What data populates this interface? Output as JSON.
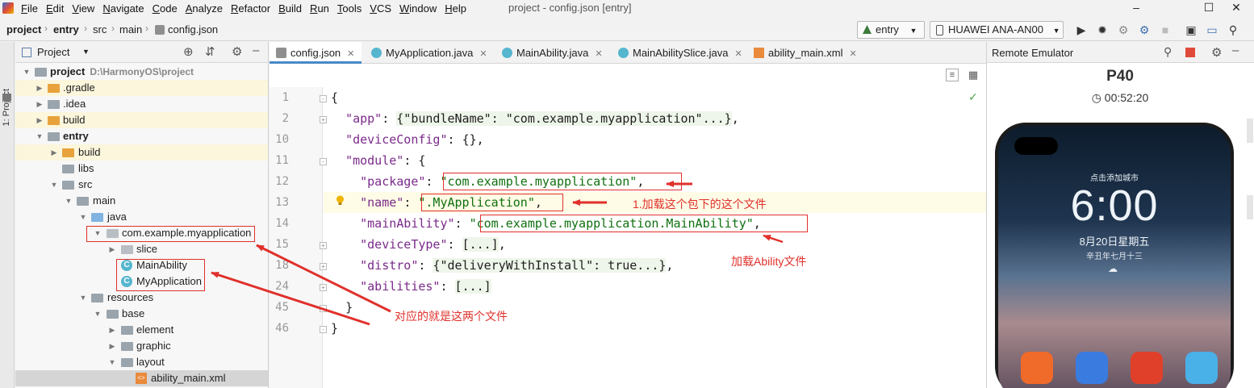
{
  "menubar": {
    "items": [
      "File",
      "Edit",
      "View",
      "Navigate",
      "Code",
      "Analyze",
      "Refactor",
      "Build",
      "Run",
      "Tools",
      "VCS",
      "Window",
      "Help"
    ],
    "window_title": "project - config.json [entry]"
  },
  "navbar": {
    "breadcrumb": [
      "project",
      "entry",
      "src",
      "main",
      "config.json"
    ],
    "run_config": "entry",
    "device": "HUAWEI ANA-AN00"
  },
  "stripe": {
    "label": "1: Project"
  },
  "project_panel": {
    "title": "Project",
    "tree": [
      {
        "label": "project",
        "path": "D:\\HarmonyOS\\project",
        "icon": "folder",
        "level": 0
      },
      {
        "label": ".gradle",
        "icon": "folder",
        "level": 1
      },
      {
        "label": ".idea",
        "icon": "folder",
        "level": 1
      },
      {
        "label": "build",
        "icon": "folder",
        "level": 1
      },
      {
        "label": "entry",
        "icon": "folder",
        "level": 1
      },
      {
        "label": "build",
        "icon": "folder",
        "level": 2
      },
      {
        "label": "libs",
        "icon": "folder",
        "level": 2
      },
      {
        "label": "src",
        "icon": "folder",
        "level": 2
      },
      {
        "label": "main",
        "icon": "folder",
        "level": 3
      },
      {
        "label": "java",
        "icon": "folder",
        "level": 4
      },
      {
        "label": "com.example.myapplication",
        "icon": "package",
        "level": 5
      },
      {
        "label": "slice",
        "icon": "package",
        "level": 6
      },
      {
        "label": "MainAbility",
        "icon": "class",
        "level": 6
      },
      {
        "label": "MyApplication",
        "icon": "class",
        "level": 6
      },
      {
        "label": "resources",
        "icon": "folder",
        "level": 4
      },
      {
        "label": "base",
        "icon": "folder",
        "level": 5
      },
      {
        "label": "element",
        "icon": "folder",
        "level": 6
      },
      {
        "label": "graphic",
        "icon": "folder",
        "level": 6
      },
      {
        "label": "layout",
        "icon": "folder",
        "level": 6
      },
      {
        "label": "ability_main.xml",
        "icon": "xml",
        "level": 7
      }
    ]
  },
  "editor": {
    "tabs": [
      "config.json",
      "MyApplication.java",
      "MainAbility.java",
      "MainAbilitySlice.java",
      "ability_main.xml"
    ],
    "active_tab": "config.json",
    "line_numbers": [
      "1",
      "2",
      "10",
      "11",
      "12",
      "13",
      "14",
      "15",
      "18",
      "24",
      "45",
      "46"
    ],
    "code": {
      "l1": "{",
      "l2_key": "\"app\"",
      "l2_val": "{\"bundleName\": \"com.example.myapplication\"...}",
      "l10_key": "\"deviceConfig\"",
      "l10_val": "{}",
      "l11_key": "\"module\"",
      "l12_key": "\"package\"",
      "l12_val": "\"com.example.myapplication\"",
      "l13_key": "\"name\"",
      "l13_val": "\".MyApplication\"",
      "l14_key": "\"mainAbility\"",
      "l14_val": "\"com.example.myapplication.MainAbility\"",
      "l15_key": "\"deviceType\"",
      "l15_val": "[...]",
      "l18_key": "\"distro\"",
      "l18_val": "{\"deliveryWithInstall\": true...}",
      "l24_key": "\"abilities\"",
      "l24_val": "[...]",
      "l45": "}",
      "l46": "}"
    }
  },
  "annotations": {
    "load_file": "1.加载这个包下的这个文件",
    "load_ability": "加载Ability文件",
    "corresponds": "对应的就是这两个文件",
    "color": "#e0302b"
  },
  "emulator": {
    "title": "Remote Emulator",
    "device_name": "P40",
    "timer": "00:52:20",
    "lock_city": "点击添加城市",
    "lock_time": "6:00",
    "lock_date": "8月20日星期五",
    "lock_lunar": "辛丑年七月十三"
  }
}
